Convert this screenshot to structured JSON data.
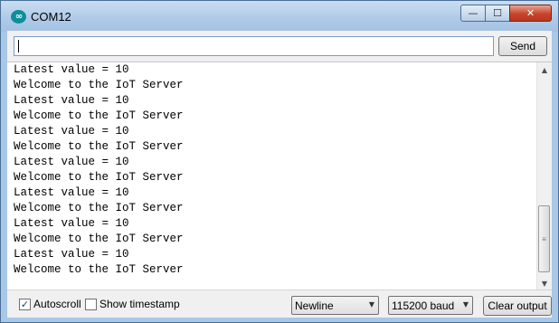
{
  "window": {
    "title": "COM12",
    "app_icon_glyph": "∞",
    "minimize_glyph": "—",
    "maximize_glyph": "☐",
    "close_glyph": "✕"
  },
  "input": {
    "value": "",
    "placeholder": "",
    "send_label": "Send"
  },
  "output": {
    "lines": [
      "Latest value = 10",
      "Welcome to the IoT Server",
      "Latest value = 10",
      "Welcome to the IoT Server",
      "Latest value = 10",
      "Welcome to the IoT Server",
      "Latest value = 10",
      "Welcome to the IoT Server",
      "Latest value = 10",
      "Welcome to the IoT Server",
      "Latest value = 10",
      "Welcome to the IoT Server",
      "Latest value = 10",
      "Welcome to the IoT Server"
    ]
  },
  "status": {
    "autoscroll_label": "Autoscroll",
    "autoscroll_checked": true,
    "timestamp_label": "Show timestamp",
    "timestamp_checked": false,
    "line_ending": "Newline",
    "baud": "115200 baud",
    "clear_label": "Clear output"
  },
  "icons": {
    "app": "arduino-icon",
    "scroll_up": "chevron-up-icon",
    "scroll_down": "chevron-down-icon",
    "dropdown": "chevron-down-icon"
  },
  "colors": {
    "titlebar": "#b0cbe8",
    "close_button": "#c7442b",
    "app_icon": "#0d8f9a"
  }
}
